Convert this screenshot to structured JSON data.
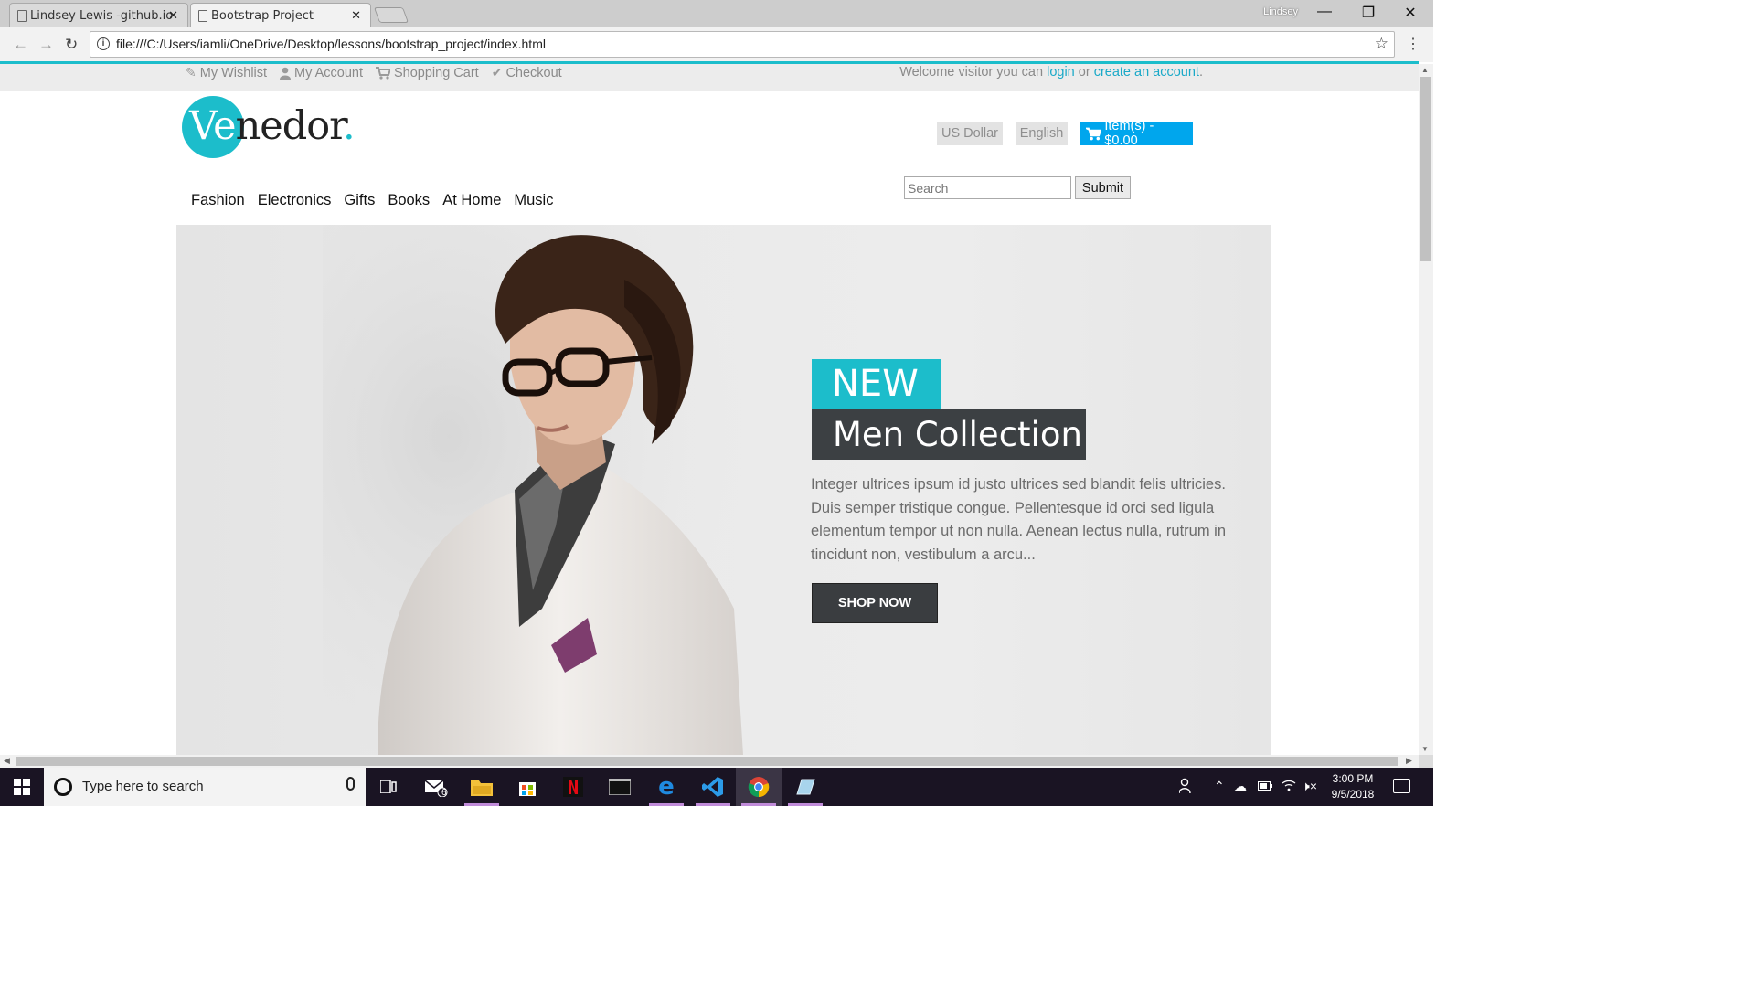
{
  "browser": {
    "tabs": [
      {
        "title": "Lindsey Lewis -github.io",
        "active": false
      },
      {
        "title": "Bootstrap Project",
        "active": true
      }
    ],
    "profile_name": "Lindsey",
    "url": "file:///C:/Users/iamli/OneDrive/Desktop/lessons/bootstrap_project/index.html",
    "accent_color": "#1cbdcb"
  },
  "page": {
    "top_links": [
      {
        "icon": "edit-icon",
        "label": "My Wishlist"
      },
      {
        "icon": "user-icon",
        "label": "My Account"
      },
      {
        "icon": "cart-icon",
        "label": "Shopping Cart"
      },
      {
        "icon": "check-icon",
        "label": "Checkout"
      }
    ],
    "welcome_prefix": "Welcome visitor you can ",
    "login_link": "login",
    "welcome_or": " or ",
    "create_account_link": "create an account",
    "welcome_suffix": ".",
    "logo": {
      "highlight": "Ve",
      "rest": "nedor",
      "dot": "."
    },
    "currency": "US Dollar",
    "language": "English",
    "cart_label": "Item(s) - $0.00",
    "nav": [
      "Fashion",
      "Electronics",
      "Gifts",
      "Books",
      "At Home",
      "Music"
    ],
    "search_placeholder": "Search",
    "submit_label": "Submit",
    "hero": {
      "tag_new": "NEW",
      "tag_collection": "Men Collection",
      "text": "Integer ultrices ipsum id justo ultrices sed blandit felis ultricies. Duis semper tristique congue. Pellentesque id orci sed ligula elementum tempor ut non nulla. Aenean lectus nulla, rutrum in tincidunt non, vestibulum a arcu...",
      "button": "SHOP NOW"
    },
    "brand_colors": {
      "teal": "#1cbdcb",
      "cart_blue": "#00a6ed",
      "dark": "#3c4043"
    }
  },
  "taskbar": {
    "search_placeholder": "Type here to search",
    "mail_badge": "6",
    "time": "3:00 PM",
    "date": "9/5/2018"
  }
}
